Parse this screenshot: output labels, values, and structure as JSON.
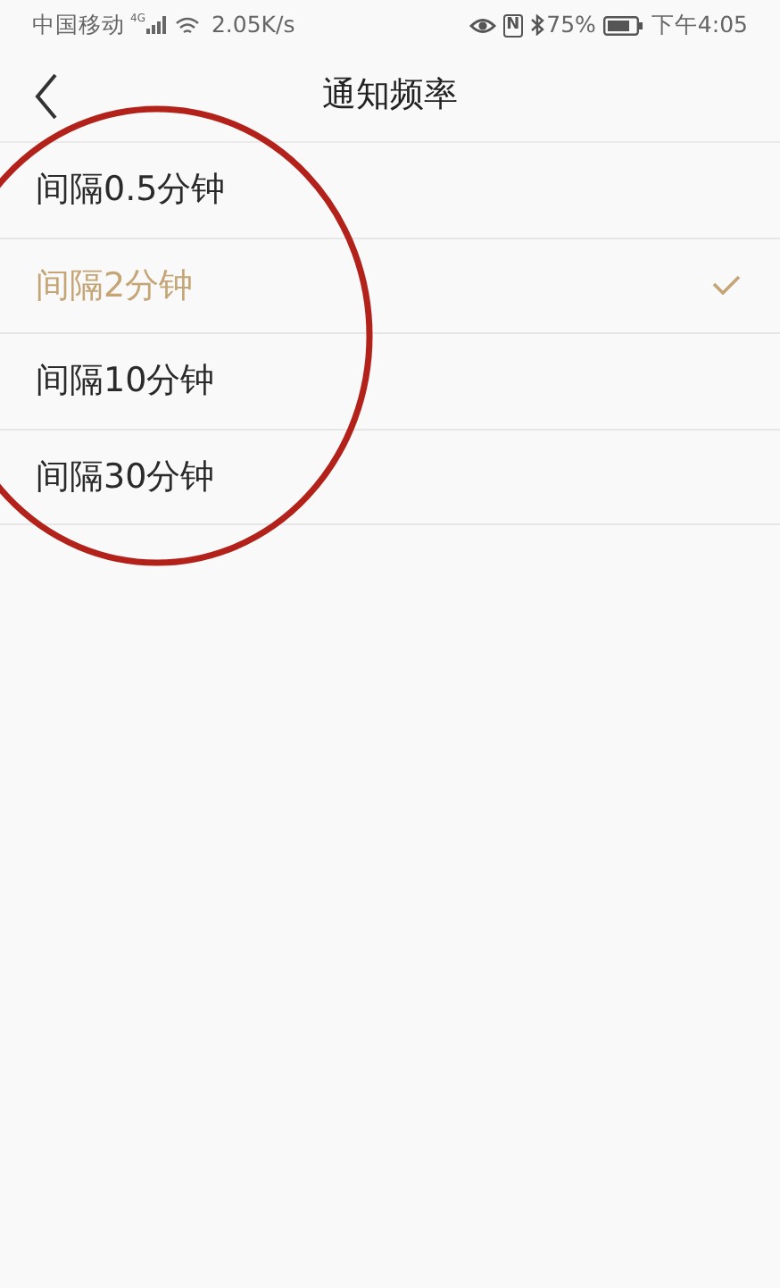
{
  "status_bar": {
    "carrier": "中国移动",
    "network": "4G",
    "speed": "2.05K/s",
    "nfc": "N",
    "battery": "75%",
    "time": "下午4:05"
  },
  "header": {
    "title": "通知频率"
  },
  "options": [
    {
      "label": "间隔0.5分钟",
      "selected": false
    },
    {
      "label": "间隔2分钟",
      "selected": true
    },
    {
      "label": "间隔10分钟",
      "selected": false
    },
    {
      "label": "间隔30分钟",
      "selected": false
    }
  ]
}
